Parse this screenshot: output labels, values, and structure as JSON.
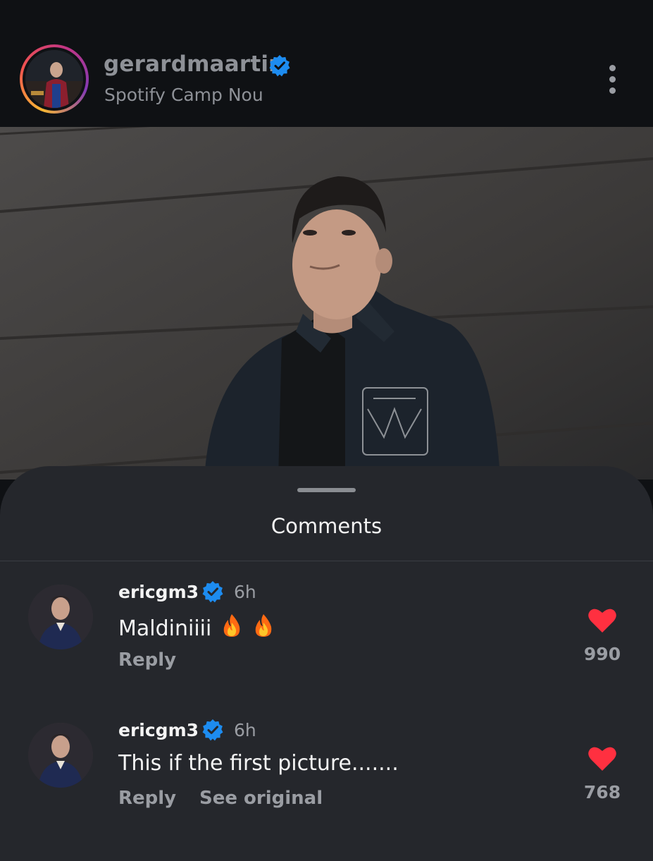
{
  "post": {
    "username": "gerardmaartin",
    "location": "Spotify Camp Nou",
    "verified_icon": "verified-badge-icon",
    "more_icon": "more-vertical-icon"
  },
  "comments_sheet": {
    "title": "Comments",
    "comments": [
      {
        "username": "ericgm3",
        "time": "6h",
        "text": "Maldiniiii",
        "emoji": "fire-icon fire-icon",
        "reply_label": "Reply",
        "likes": "990"
      },
      {
        "username": "ericgm3",
        "time": "6h",
        "text": "This if the first picture.......",
        "reply_label": "Reply",
        "see_original_label": "See original",
        "likes": "768"
      }
    ]
  },
  "colors": {
    "background": "#0f1114",
    "sheet": "#25272c",
    "verified": "#1d8cf0",
    "heart": "#ff3040"
  }
}
